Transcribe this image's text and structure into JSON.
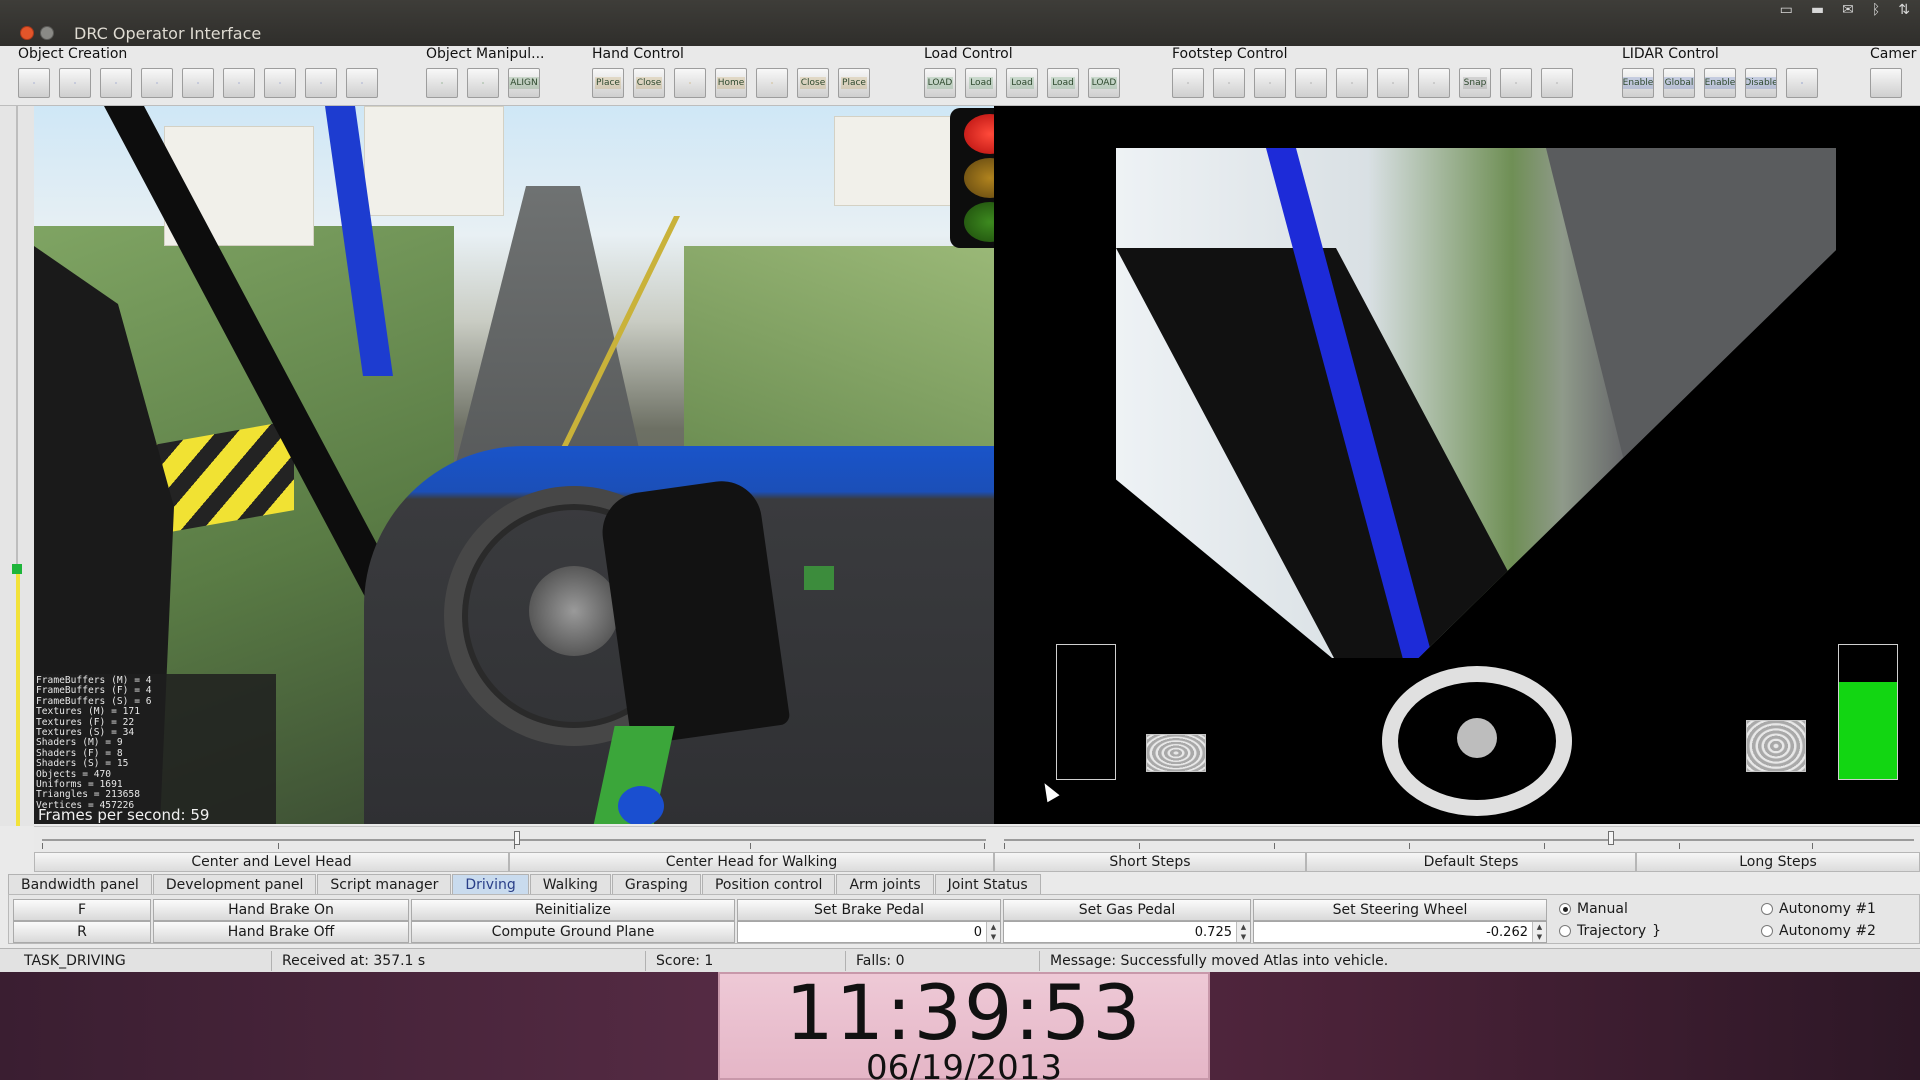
{
  "window": {
    "title": "DRC Operator Interface"
  },
  "toolbar": {
    "groups": [
      {
        "label": "Object Creation",
        "icons": [
          "",
          "",
          "",
          "",
          "",
          "",
          "",
          "",
          ""
        ]
      },
      {
        "label": "Object Manipul...",
        "icons": [
          "",
          "",
          "ALIGN"
        ]
      },
      {
        "label": "Hand Control",
        "icons": [
          "Place",
          "Close",
          "",
          "Home",
          "",
          "Close",
          "Place"
        ]
      },
      {
        "label": "Load Control",
        "icons": [
          "LOAD",
          "Load",
          "Load",
          "Load",
          "LOAD"
        ]
      },
      {
        "label": "Footstep Control",
        "icons": [
          "",
          "",
          "",
          "",
          "",
          "",
          "",
          "Snap",
          "",
          ""
        ]
      },
      {
        "label": "LIDAR Control",
        "icons": [
          "Enable",
          "Global",
          "Enable",
          "Disable",
          ""
        ]
      },
      {
        "label": "Camer",
        "icons": [
          ""
        ]
      }
    ]
  },
  "stats": {
    "lines": [
      "FrameBuffers (M) = 4",
      "FrameBuffers (F) = 4",
      "FrameBuffers (S) = 6",
      "Textures (M) = 171",
      "Textures (F) = 22",
      "Textures (S) = 34",
      "Shaders (M) = 9",
      "Shaders (F) = 8",
      "Shaders (S) = 15",
      "Objects = 470",
      "Uniforms = 1691",
      "Triangles = 213658",
      "Vertices = 457226"
    ],
    "fps": "Frames per second: 59"
  },
  "gauges": {
    "brake_fraction": 0,
    "gas_fraction": 0.725
  },
  "head_buttons": {
    "center_level": "Center and Level Head",
    "center_walking": "Center Head for Walking",
    "short_steps": "Short Steps",
    "default_steps": "Default Steps",
    "long_steps": "Long Steps"
  },
  "tabs": [
    {
      "label": "Bandwidth panel",
      "active": false
    },
    {
      "label": "Development panel",
      "active": false
    },
    {
      "label": "Script manager",
      "active": false
    },
    {
      "label": "Driving",
      "active": true
    },
    {
      "label": "Walking",
      "active": false
    },
    {
      "label": "Grasping",
      "active": false
    },
    {
      "label": "Position control",
      "active": false
    },
    {
      "label": "Arm joints",
      "active": false
    },
    {
      "label": "Joint Status",
      "active": false
    }
  ],
  "driving": {
    "forward": "F",
    "reverse": "R",
    "hand_brake_on": "Hand Brake On",
    "hand_brake_off": "Hand Brake Off",
    "reinitialize": "Reinitialize",
    "compute_ground": "Compute Ground Plane",
    "set_brake": "Set Brake Pedal",
    "set_gas": "Set Gas Pedal",
    "set_steering": "Set Steering Wheel",
    "brake_value": "0",
    "gas_value": "0.725",
    "steering_value": "-0.262",
    "modes": {
      "manual": "Manual",
      "trajectory": "Trajectory",
      "autonomy1": "Autonomy #1",
      "autonomy2": "Autonomy #2",
      "selected": "Manual"
    }
  },
  "status": {
    "task": "TASK_DRIVING",
    "received": "Received at:  357.1 s",
    "score": "Score:  1",
    "falls": "Falls:  0",
    "message": "Message:  Successfully moved Atlas into vehicle."
  },
  "clock": {
    "time": "11:39:53",
    "date": "06/19/2013"
  },
  "colors": {
    "active_tab": "#c9dbee",
    "gas_fill": "#12d612",
    "traffic_red": "#ff4a3a"
  }
}
